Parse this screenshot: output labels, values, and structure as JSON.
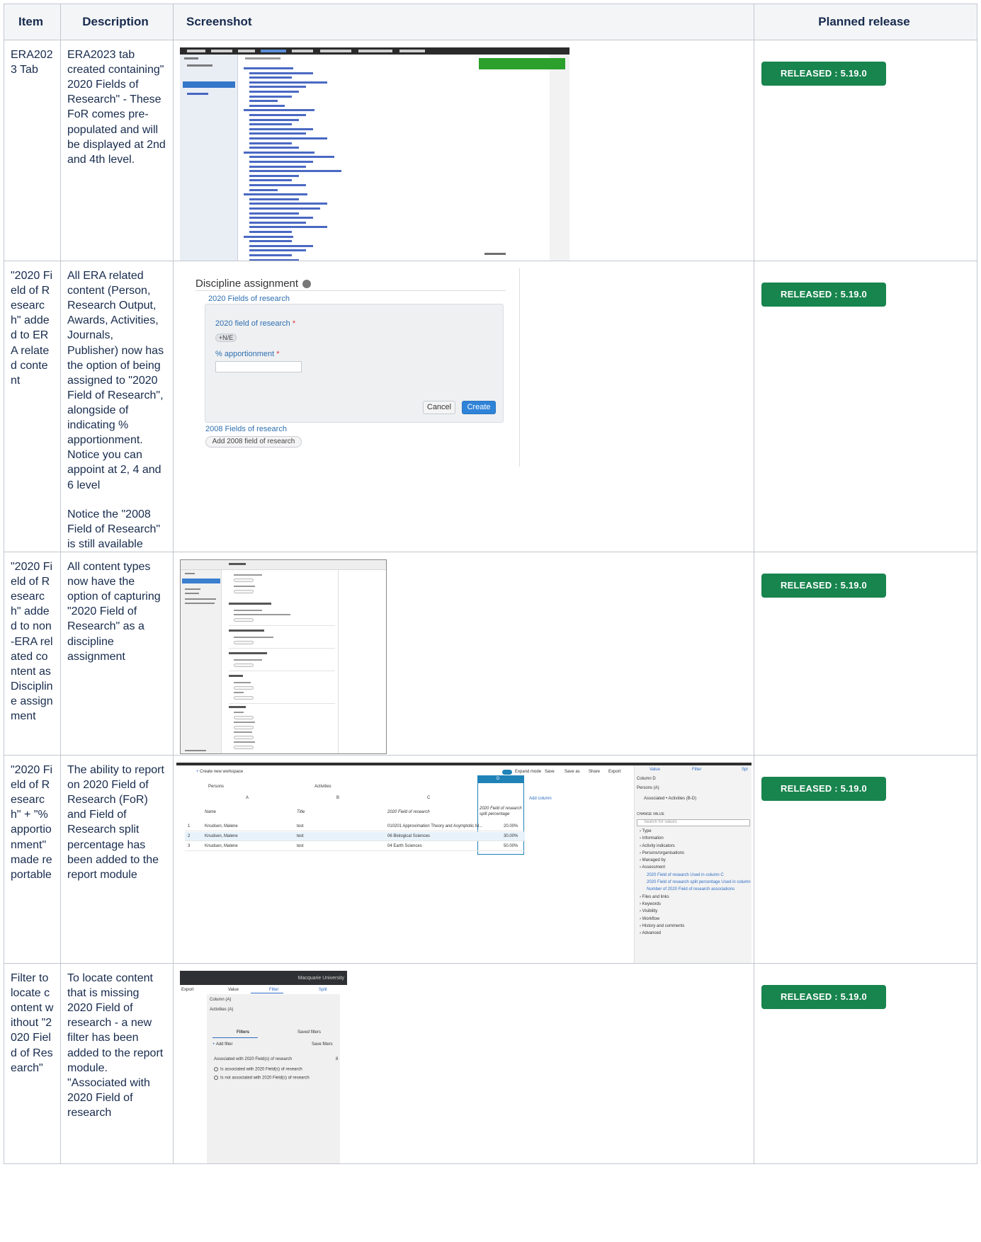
{
  "table": {
    "headers": {
      "item": "Item",
      "description": "Description",
      "screenshot": "Screenshot",
      "release": "Planned release"
    },
    "rows": [
      {
        "item": "ERA2023 Tab",
        "description": "ERA2023 tab created containing\" 2020 Fields of Research\" - These FoR comes pre-populated and will be displayed at 2nd and 4th level.",
        "release": "RELEASED : 5.19.0"
      },
      {
        "item": "\"2020 Field of Research\" added to ERA related content",
        "description": "All ERA related content (Person, Research Output, Awards, Activities, Journals, Publisher) now has the option of being assigned to \"2020 Field of Research\", alongside of indicating % apportionment. Notice you can appoint at 2, 4 and 6 level",
        "description2": "Notice the \"2008 Field of Research\" is still available",
        "release": "RELEASED : 5.19.0"
      },
      {
        "item": "\"2020 Field of Research\" added to non-ERA related content as Discipline assignment",
        "description": "All content types now have the option of capturing \"2020 Field of Research\" as a discipline assignment",
        "release": "RELEASED : 5.19.0"
      },
      {
        "item": "\"2020 Field of Research\" + \"% apportionment\" made reportable",
        "description": "The ability to report on 2020 Field of Research (FoR) and Field of Research split percentage has been added to the report module",
        "release": "RELEASED : 5.19.0"
      },
      {
        "item": "Filter to locate content without \"2020 Field of Research\"",
        "description": "To locate content that is missing 2020 Field of research - a new filter has been added to the report module. \"Associated with 2020 Field of research",
        "release": "RELEASED : 5.19.0"
      }
    ]
  },
  "shot2": {
    "title": "Discipline assignment",
    "fields_2020": "2020 Fields of research",
    "field_label": "2020 field of research",
    "chip": "+N/E",
    "apportionment_label": "% apportionment",
    "cancel": "Cancel",
    "create": "Create",
    "fields_2008": "2008 Fields of research",
    "add_2008": "Add 2008 field of research"
  },
  "shot4": {
    "create_workspace": "Create new workspace",
    "expand_mode": "Expand mode",
    "save": "Save",
    "save_as": "Save as",
    "share": "Share",
    "export": "Export",
    "tab_value": "Value",
    "tab_filter": "Filter",
    "tab_split": "Spl",
    "persons": "Persons",
    "activities": "Activities",
    "col_a": "A",
    "col_b": "B",
    "col_c": "C",
    "col_d": "D",
    "add_column": "Add column",
    "h_name": "Name",
    "h_title": "Title",
    "h_for": "2020 Field of research",
    "h_split": "2020 Field of research split percentage",
    "rows": [
      {
        "n": "1",
        "name": "Knudsen, Malene",
        "title": "test",
        "for": "010201 Approximation Theory and Asymptotic M...",
        "pct": "20.00%"
      },
      {
        "n": "2",
        "name": "Knudsen, Malene",
        "title": "test",
        "for": "06 Biological Sciences",
        "pct": "30.00%"
      },
      {
        "n": "3",
        "name": "Knudsen, Malene",
        "title": "test",
        "for": "04 Earth Sciences",
        "pct": "50.00%"
      }
    ],
    "panel_column": "Column D",
    "panel_persons": "Persons (A)",
    "panel_assoc": "Associated • Activities (B-D)",
    "change_value": "CHANGE VALUE",
    "search_placeholder": "Search for values",
    "tree": [
      "Type",
      "Information",
      "Activity indicators",
      "Persons/organisations",
      "Managed by",
      "Assessment"
    ],
    "assess_1": "2020 Field of research",
    "assess_1_note": "Used in column C",
    "assess_2": "2020 Field of research split percentage",
    "assess_2_note": "Used in column D",
    "assess_3": "Number of 2020 Field of research associations",
    "tree2": [
      "Files and links",
      "Keywords",
      "Visibility",
      "Workflow",
      "History and comments",
      "Advanced"
    ]
  },
  "shot5": {
    "org": "Macquarie University",
    "export": "Export",
    "value": "Value",
    "filter": "Filter",
    "split": "Split",
    "column": "Column (A)",
    "activities": "Activities (A)",
    "filters": "Filters",
    "saved_filters": "Saved filters",
    "add_filter": "Add filter",
    "save_filters": "Save filters",
    "group": "Associated with 2020 Field(s) of research",
    "count": "8",
    "opt1": "Is associated with 2020 Field(s) of research",
    "opt2": "Is not associated with 2020 Field(s) of research"
  }
}
